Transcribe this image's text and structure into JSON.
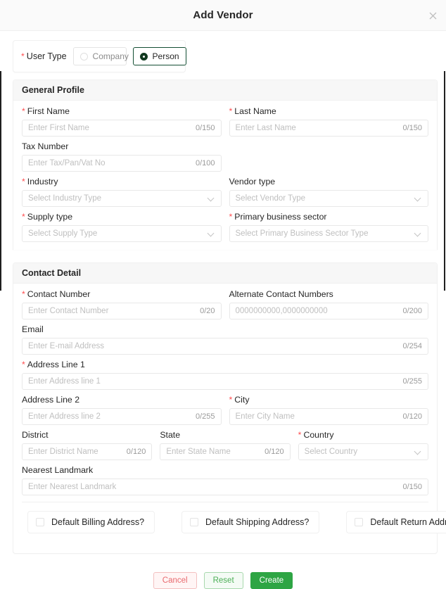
{
  "modal": {
    "title": "Add Vendor",
    "close_icon": "close-icon"
  },
  "user_type": {
    "label": "User Type",
    "required_marker": "*",
    "options": [
      {
        "label": "Company",
        "selected": false
      },
      {
        "label": "Person",
        "selected": true
      }
    ],
    "selected_value": "Person",
    "selected_border_color": "#134e33"
  },
  "general_profile": {
    "heading": "General Profile",
    "fields": {
      "first_name": {
        "label": "First Name",
        "required": true,
        "placeholder": "Enter First Name",
        "counter": "0/150",
        "value": ""
      },
      "last_name": {
        "label": "Last Name",
        "required": true,
        "placeholder": "Enter Last Name",
        "counter": "0/150",
        "value": ""
      },
      "tax_number": {
        "label": "Tax Number",
        "required": false,
        "placeholder": "Enter Tax/Pan/Vat No",
        "counter": "0/100",
        "value": ""
      },
      "industry": {
        "label": "Industry",
        "required": true,
        "placeholder": "Select Industry Type",
        "value": ""
      },
      "vendor_type": {
        "label": "Vendor type",
        "required": false,
        "placeholder": "Select Vendor Type",
        "value": ""
      },
      "supply_type": {
        "label": "Supply type",
        "required": true,
        "placeholder": "Select Supply Type",
        "value": ""
      },
      "primary_business_sector": {
        "label": "Primary business sector",
        "required": true,
        "placeholder": "Select Primary Business Sector Type",
        "value": ""
      }
    }
  },
  "contact_detail": {
    "heading": "Contact Detail",
    "fields": {
      "contact_number": {
        "label": "Contact Number",
        "required": true,
        "placeholder": "Enter Contact Number",
        "counter": "0/20",
        "value": ""
      },
      "alternate_contact_numbers": {
        "label": "Alternate Contact Numbers",
        "required": false,
        "placeholder": "0000000000,0000000000",
        "counter": "0/200",
        "value": ""
      },
      "email": {
        "label": "Email",
        "required": false,
        "placeholder": "Enter E-mail Address",
        "counter": "0/254",
        "value": ""
      },
      "address_line_1": {
        "label": "Address Line 1",
        "required": true,
        "placeholder": "Enter Address line 1",
        "counter": "0/255",
        "value": ""
      },
      "address_line_2": {
        "label": "Address Line 2",
        "required": false,
        "placeholder": "Enter Address line 2",
        "counter": "0/255",
        "value": ""
      },
      "city": {
        "label": "City",
        "required": true,
        "placeholder": "Enter City Name",
        "counter": "0/120",
        "value": ""
      },
      "district": {
        "label": "District",
        "required": false,
        "placeholder": "Enter District Name",
        "counter": "0/120",
        "value": ""
      },
      "state": {
        "label": "State",
        "required": false,
        "placeholder": "Enter State Name",
        "counter": "0/120",
        "value": ""
      },
      "country": {
        "label": "Country",
        "required": true,
        "placeholder": "Select Country",
        "value": ""
      },
      "nearest_landmark": {
        "label": "Nearest Landmark",
        "required": false,
        "placeholder": "Enter Nearest Landmark",
        "counter": "0/150",
        "value": ""
      }
    },
    "checkboxes": [
      {
        "label": "Default Billing Address?",
        "checked": false
      },
      {
        "label": "Default Shipping Address?",
        "checked": false
      },
      {
        "label": "Default Return Address?",
        "checked": false
      }
    ]
  },
  "footer": {
    "cancel_label": "Cancel",
    "reset_label": "Reset",
    "create_label": "Create",
    "cancel_color": "#e8696e",
    "reset_color": "#4caf56",
    "create_bg": "#2ea544"
  }
}
